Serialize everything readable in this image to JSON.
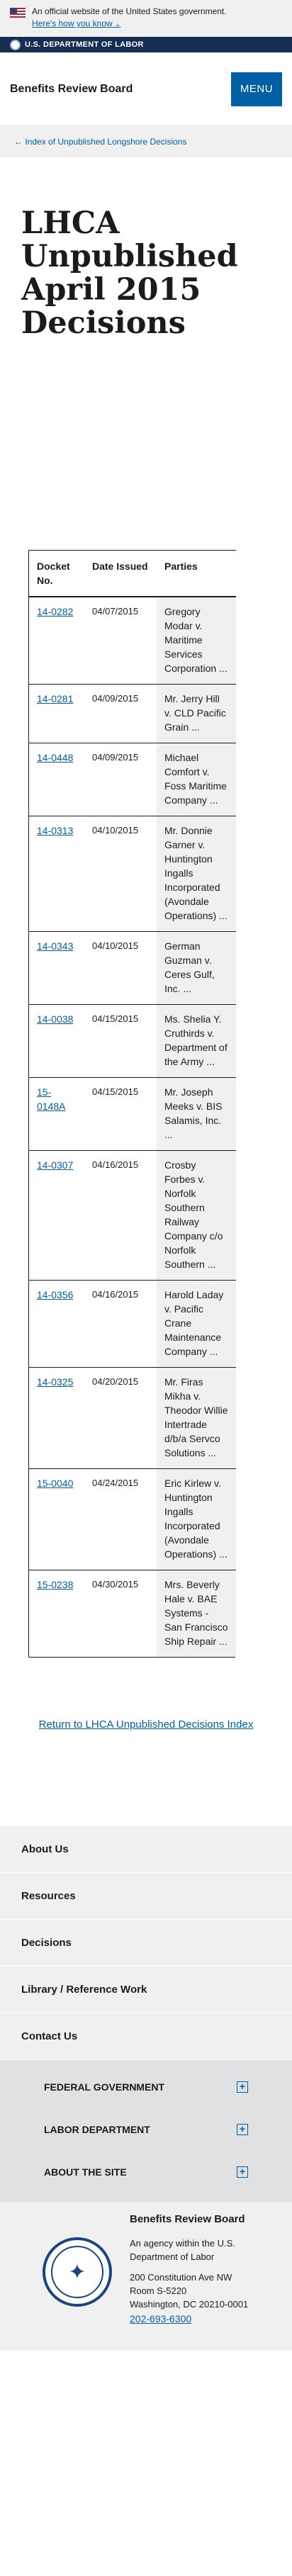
{
  "gov_banner": {
    "text": "An official website of the United States government.",
    "link": "Here's how you know",
    "chevron": "⌄"
  },
  "agency_bar": {
    "name": "U.S. DEPARTMENT OF LABOR"
  },
  "header": {
    "title": "Benefits Review Board",
    "menu_label": "MENU"
  },
  "breadcrumb": {
    "label": "Index of Unpublished Longshore Decisions",
    "arrow": "←"
  },
  "page": {
    "title": "LHCA Unpublished April 2015 Decisions"
  },
  "table": {
    "headers": [
      "Docket No.",
      "Date Issued",
      "Parties"
    ],
    "rows": [
      {
        "docket": "14-0282",
        "date": "04/07/2015",
        "parties": "Gregory Modar v. Maritime Services Corporation ..."
      },
      {
        "docket": "14-0281",
        "date": "04/09/2015",
        "parties": "Mr. Jerry Hill v. CLD Pacific Grain ..."
      },
      {
        "docket": "14-0448",
        "date": "04/09/2015",
        "parties": "Michael Comfort v. Foss Maritime Company ..."
      },
      {
        "docket": "14-0313",
        "date": "04/10/2015",
        "parties": "Mr. Donnie Garner v. Huntington Ingalls Incorporated (Avondale Operations) ..."
      },
      {
        "docket": "14-0343",
        "date": "04/10/2015",
        "parties": "German Guzman v. Ceres Gulf, Inc. ..."
      },
      {
        "docket": "14-0038",
        "date": "04/15/2015",
        "parties": "Ms. Shelia Y. Cruthirds v. Department of the Army ..."
      },
      {
        "docket": "15-0148A",
        "date": "04/15/2015",
        "parties": "Mr. Joseph Meeks v. BIS Salamis, Inc. ..."
      },
      {
        "docket": "14-0307",
        "date": "04/16/2015",
        "parties": "Crosby Forbes v. Norfolk Southern Railway Company c/o Norfolk Southern ..."
      },
      {
        "docket": "14-0356",
        "date": "04/16/2015",
        "parties": "Harold Laday v. Pacific Crane Maintenance Company ..."
      },
      {
        "docket": "14-0325",
        "date": "04/20/2015",
        "parties": "Mr. Firas Mikha v. Theodor Willie Intertrade d/b/a Servco Solutions ..."
      },
      {
        "docket": "15-0040",
        "date": "04/24/2015",
        "parties": "Eric Kirlew v. Huntington Ingalls Incorporated (Avondale Operations) ..."
      },
      {
        "docket": "15-0238",
        "date": "04/30/2015",
        "parties": "Mrs. Beverly Hale v. BAE Systems - San Francisco Ship Repair ..."
      }
    ]
  },
  "return_link": {
    "label": "Return to LHCA Unpublished Decisions Index"
  },
  "footer_nav": [
    "About Us",
    "Resources",
    "Decisions",
    "Library / Reference Work",
    "Contact Us"
  ],
  "federal_nav": [
    {
      "label": "FEDERAL GOVERNMENT",
      "icon": "plus-icon"
    },
    {
      "label": "LABOR DEPARTMENT",
      "icon": "plus-icon"
    },
    {
      "label": "ABOUT THE SITE",
      "icon": "plus-icon"
    }
  ],
  "footer_info": {
    "title": "Benefits Review Board",
    "agency_line": "An agency within the U.S. Department of Labor",
    "address1": "200 Constitution Ave NW",
    "address2": "Room S-5220",
    "address3": "Washington, DC 20210-0001",
    "phone": "202-693-6300"
  },
  "colors": {
    "link": "#005ea2",
    "dol_navy": "#162e51",
    "menu": "#005ea2",
    "gray_bg": "#f0f0f0"
  }
}
